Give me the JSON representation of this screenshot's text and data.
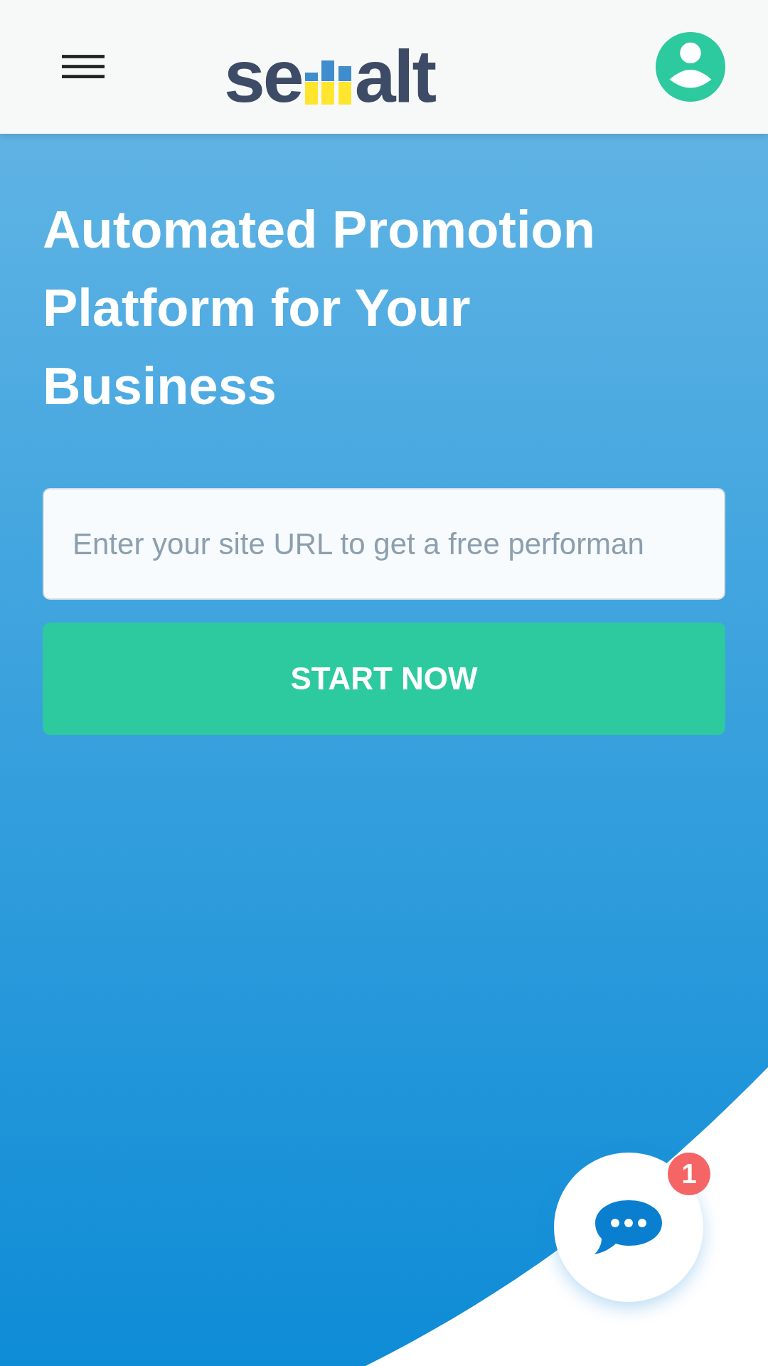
{
  "header": {
    "logo": {
      "left": "se",
      "right": "alt"
    }
  },
  "hero": {
    "title": "Automated Promotion Platform for Your Business",
    "url_field": {
      "placeholder": "Enter your site URL to get a free performan"
    },
    "start_button": "START NOW"
  },
  "chat": {
    "badge": "1"
  }
}
